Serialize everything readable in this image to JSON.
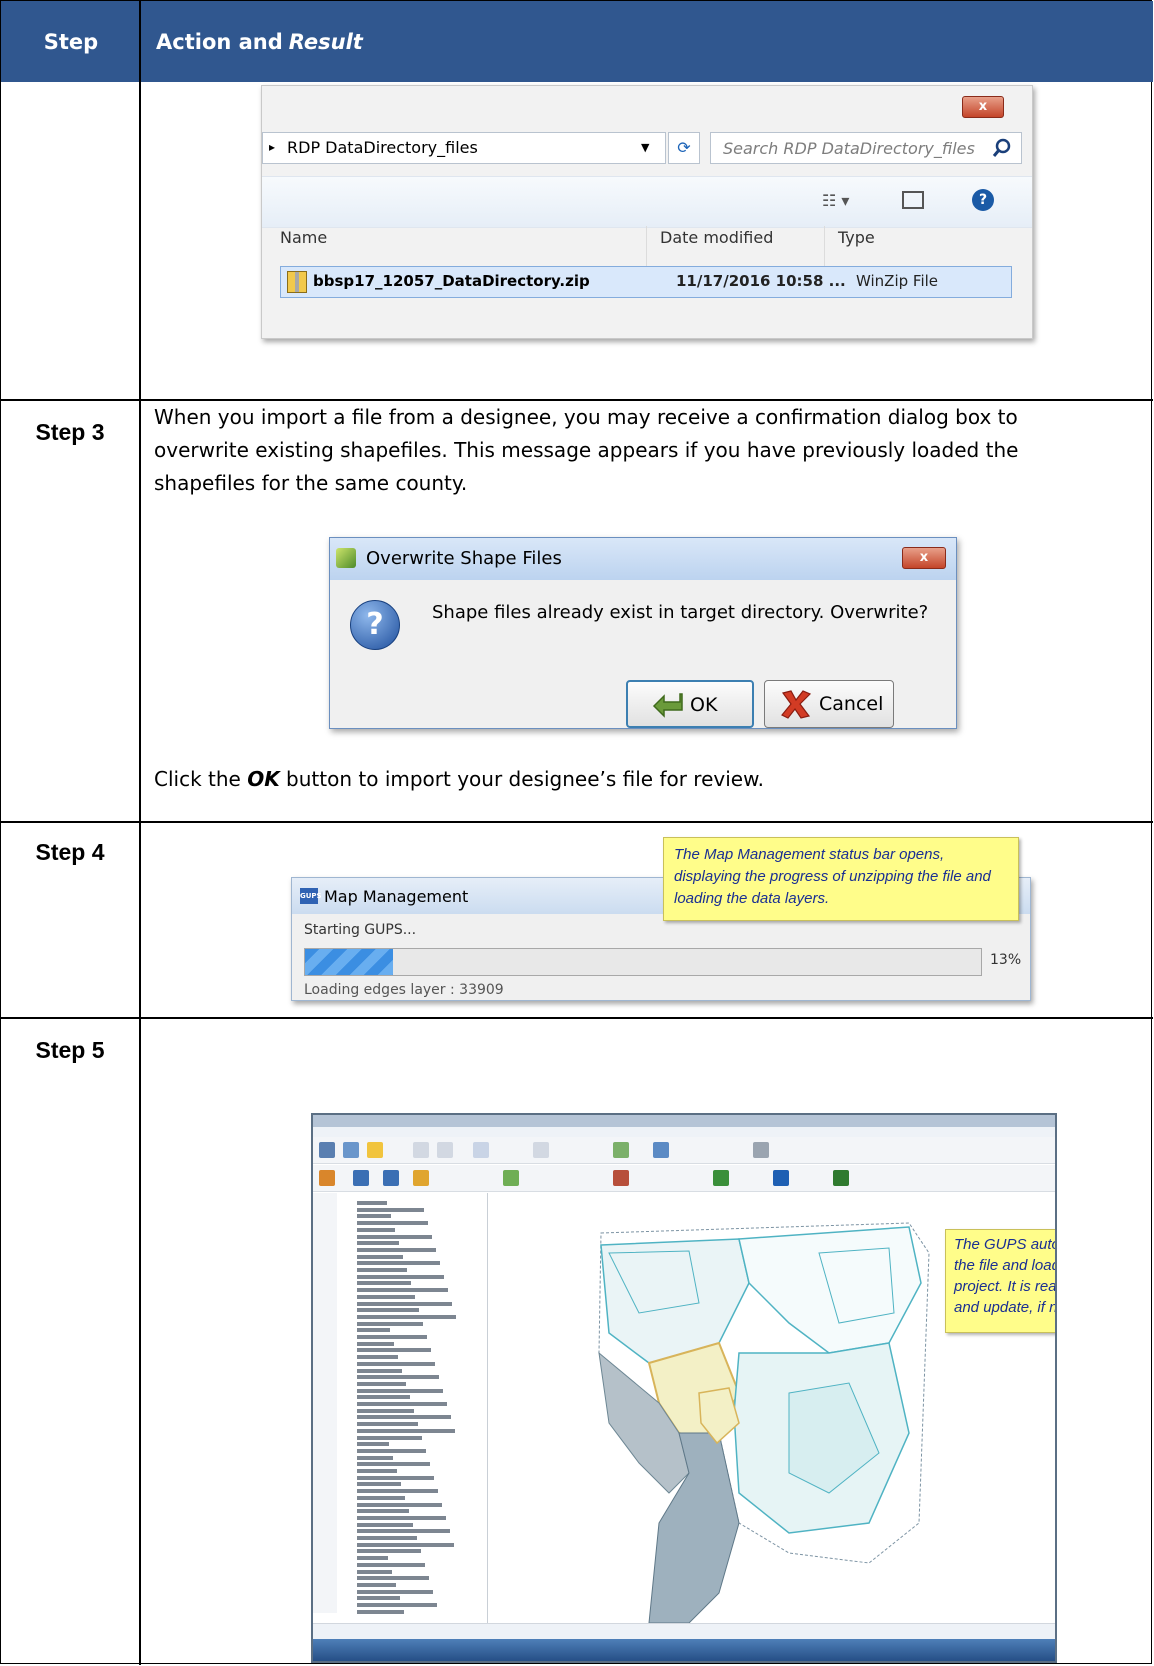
{
  "table": {
    "header": {
      "col1": "Step",
      "col2_plain": "Action and",
      "col2_italic": "Result"
    }
  },
  "explorer": {
    "close_label": "x",
    "address": "RDP DataDirectory_files",
    "address_arrow": "▸",
    "search_placeholder": "Search RDP DataDirectory_files",
    "columns": {
      "name": "Name",
      "date": "Date modified",
      "type": "Type"
    },
    "file": {
      "name": "bbsp17_12057_DataDirectory.zip",
      "date": "11/17/2016 10:58 ...",
      "type": "WinZip File"
    }
  },
  "step3": {
    "label": "Step 3",
    "intro": "When you import a file from a designee, you may receive a confirmation dialog box to overwrite existing shapefiles. This message appears if you have previously loaded the shapefiles for the same county.",
    "dialog": {
      "title": "Overwrite Shape Files",
      "close_label": "x",
      "message": "Shape files already exist in target directory.  Overwrite?",
      "ok_label": "OK",
      "cancel_label": "Cancel"
    },
    "instruction_prefix": "Click the ",
    "instruction_bold": "OK",
    "instruction_suffix": " button to import your designee’s file for review."
  },
  "step4": {
    "label": "Step 4",
    "callout": "The Map Management status bar opens, displaying the progress of unzipping the file and loading the data layers.",
    "window_title": "Map Management",
    "icon_text": "GUPS",
    "status": "Starting GUPS...",
    "progress_percent": 13,
    "progress_label": "13%",
    "loading": "Loading edges layer : 33909"
  },
  "step5": {
    "label": "Step 5",
    "callout": "The GUPS automatically unzips the file and loads the county project. It is ready for your review and update, if necessary.",
    "accent_colors": {
      "county_outline": "#4fb3c3",
      "urban": "#f3f0c6",
      "water": "#b5c1c9"
    }
  }
}
